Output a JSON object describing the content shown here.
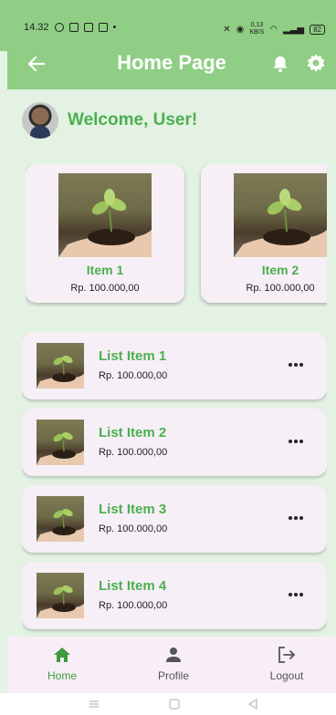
{
  "status_bar": {
    "time": "14.32",
    "speed_value": "0,13",
    "speed_unit": "KB/S",
    "battery": "82"
  },
  "app_bar": {
    "title": "Home Page"
  },
  "welcome": {
    "text": "Welcome, User!"
  },
  "featured": [
    {
      "name": "Item 1",
      "price": "Rp. 100.000,00"
    },
    {
      "name": "Item 2",
      "price": "Rp. 100.000,00"
    }
  ],
  "list": [
    {
      "name": "List Item 1",
      "price": "Rp. 100.000,00"
    },
    {
      "name": "List Item 2",
      "price": "Rp. 100.000,00"
    },
    {
      "name": "List Item 3",
      "price": "Rp. 100.000,00"
    },
    {
      "name": "List Item 4",
      "price": "Rp. 100.000,00"
    }
  ],
  "bottom_nav": {
    "home_label": "Home",
    "profile_label": "Profile",
    "logout_label": "Logout"
  },
  "colors": {
    "app_bar": "#8fce84",
    "accent_green": "#4caf50",
    "background": "#e3f2e3",
    "card": "#f6eff6"
  },
  "icons": [
    "back-arrow-icon",
    "bell-icon",
    "gear-icon",
    "more-dots-icon",
    "home-icon",
    "person-icon",
    "logout-icon"
  ]
}
